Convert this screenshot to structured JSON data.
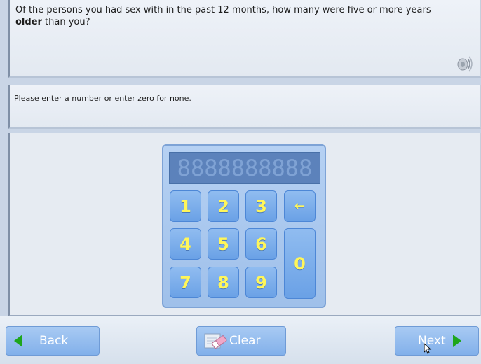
{
  "question": {
    "text_before": "Of the persons you had sex with in the past 12 months, how many were five or more years ",
    "bold": "older",
    "text_after": " than you?"
  },
  "instruction": "Please enter a number or enter zero for none.",
  "keypad": {
    "display": "8888888888",
    "keys": [
      "1",
      "2",
      "3",
      "←",
      "4",
      "5",
      "6",
      "0",
      "7",
      "8",
      "9"
    ]
  },
  "footer": {
    "back_label": "Back",
    "clear_label": "Clear",
    "next_label": "Next"
  },
  "icons": {
    "speaker": "speaker-icon",
    "eraser": "eraser-icon",
    "back": "arrow-left-icon",
    "next": "arrow-right-icon"
  },
  "colors": {
    "key_text": "#fff65a",
    "key_bg": "#7aaeea",
    "arrow": "#1ea61c"
  }
}
